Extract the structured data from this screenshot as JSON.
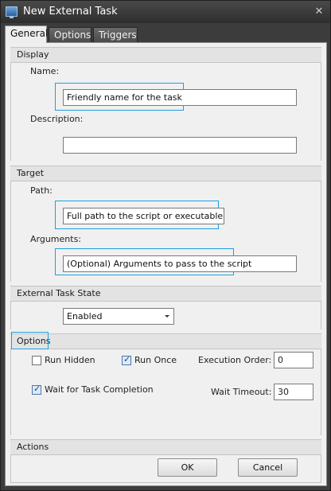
{
  "window": {
    "title": "New External Task",
    "close_glyph": "✕"
  },
  "tabs": [
    "General",
    "Options",
    "Triggers"
  ],
  "display": {
    "header": "Display",
    "name_label": "Name:",
    "name_value": "Friendly name for the task",
    "description_label": "Description:",
    "description_value": ""
  },
  "target": {
    "header": "Target",
    "path_label": "Path:",
    "path_value": "Full path to the script or executable",
    "arguments_label": "Arguments:",
    "arguments_value": "(Optional) Arguments to pass to the script"
  },
  "state": {
    "header": "External Task State",
    "selected": "Enabled"
  },
  "options": {
    "header": "Options",
    "run_hidden_label": "Run Hidden",
    "run_hidden_checked": false,
    "run_once_label": "Run Once",
    "run_once_checked": true,
    "execution_order_label": "Execution Order:",
    "execution_order_value": "0",
    "wait_completion_label": "Wait for Task Completion",
    "wait_completion_checked": true,
    "wait_timeout_label": "Wait Timeout:",
    "wait_timeout_value": "30"
  },
  "actions": {
    "header": "Actions",
    "ok_label": "OK",
    "cancel_label": "Cancel"
  },
  "colors": {
    "highlight_border": "#1f9fe0",
    "window_chrome": "#3c3c3c"
  }
}
